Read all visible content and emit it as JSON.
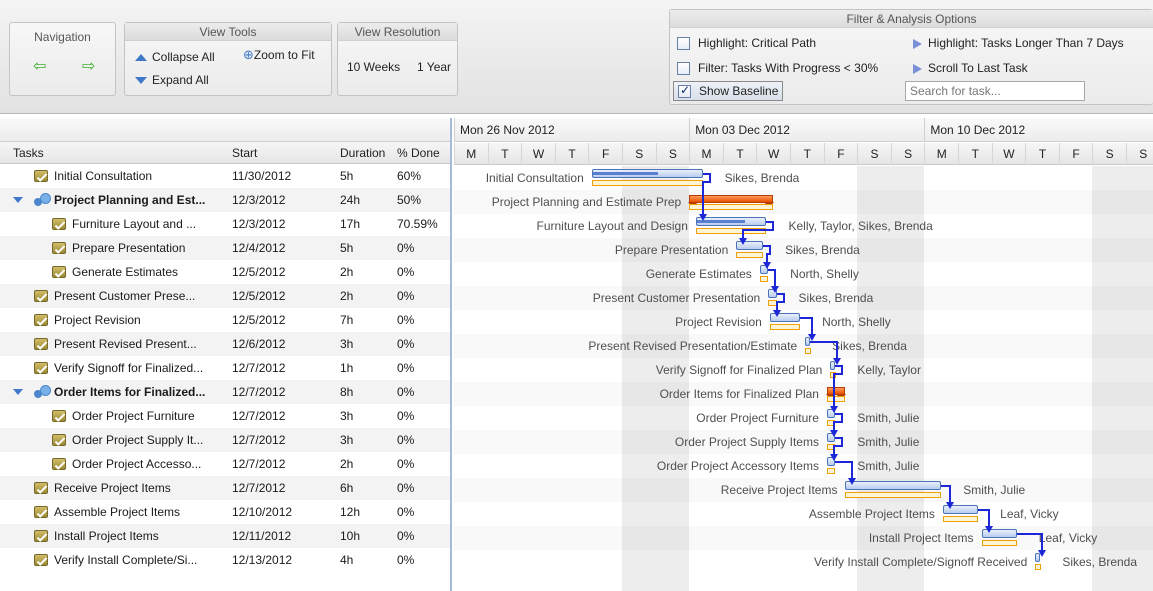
{
  "toolbar": {
    "navigation": {
      "title": "Navigation",
      "back_icon": "arrow-left-icon",
      "forward_icon": "arrow-right-icon"
    },
    "view_tools": {
      "title": "View Tools",
      "collapse_all": "Collapse All",
      "zoom_to_fit": "Zoom to Fit",
      "expand_all": "Expand All"
    },
    "view_resolution": {
      "title": "View Resolution",
      "weeks": "10 Weeks",
      "year": "1 Year"
    },
    "filter": {
      "title": "Filter & Analysis Options",
      "highlight_critical": "Highlight: Critical Path",
      "filter_progress": "Filter: Tasks With Progress < 30%",
      "show_baseline": "Show Baseline",
      "show_baseline_checked": true,
      "highlight_longer": "Highlight: Tasks Longer Than 7 Days",
      "scroll_last": "Scroll To Last Task",
      "search_placeholder": "Search for task..."
    }
  },
  "grid": {
    "columns": {
      "tasks": "Tasks",
      "start": "Start",
      "duration": "Duration",
      "done": "% Done"
    },
    "rows": [
      {
        "name": "Initial Consultation",
        "start": "11/30/2012",
        "duration": "5h",
        "done": "60%",
        "level": 0,
        "summary": false
      },
      {
        "name": "Project Planning and Est...",
        "start": "12/3/2012",
        "duration": "24h",
        "done": "50%",
        "level": 0,
        "summary": true
      },
      {
        "name": "Furniture Layout and ...",
        "start": "12/3/2012",
        "duration": "17h",
        "done": "70.59%",
        "level": 1,
        "summary": false
      },
      {
        "name": "Prepare Presentation",
        "start": "12/4/2012",
        "duration": "5h",
        "done": "0%",
        "level": 1,
        "summary": false
      },
      {
        "name": "Generate Estimates",
        "start": "12/5/2012",
        "duration": "2h",
        "done": "0%",
        "level": 1,
        "summary": false
      },
      {
        "name": "Present Customer Prese...",
        "start": "12/5/2012",
        "duration": "2h",
        "done": "0%",
        "level": 0,
        "summary": false
      },
      {
        "name": "Project Revision",
        "start": "12/5/2012",
        "duration": "7h",
        "done": "0%",
        "level": 0,
        "summary": false
      },
      {
        "name": "Present Revised Present...",
        "start": "12/6/2012",
        "duration": "3h",
        "done": "0%",
        "level": 0,
        "summary": false
      },
      {
        "name": "Verify Signoff for Finalized...",
        "start": "12/7/2012",
        "duration": "1h",
        "done": "0%",
        "level": 0,
        "summary": false
      },
      {
        "name": "Order Items for Finalized...",
        "start": "12/7/2012",
        "duration": "8h",
        "done": "0%",
        "level": 0,
        "summary": true
      },
      {
        "name": "Order Project Furniture",
        "start": "12/7/2012",
        "duration": "3h",
        "done": "0%",
        "level": 1,
        "summary": false
      },
      {
        "name": "Order Project Supply It...",
        "start": "12/7/2012",
        "duration": "3h",
        "done": "0%",
        "level": 1,
        "summary": false
      },
      {
        "name": "Order Project Accesso...",
        "start": "12/7/2012",
        "duration": "2h",
        "done": "0%",
        "level": 1,
        "summary": false
      },
      {
        "name": "Receive Project Items",
        "start": "12/7/2012",
        "duration": "6h",
        "done": "0%",
        "level": 0,
        "summary": false
      },
      {
        "name": "Assemble Project Items",
        "start": "12/10/2012",
        "duration": "12h",
        "done": "0%",
        "level": 0,
        "summary": false
      },
      {
        "name": "Install Project Items",
        "start": "12/11/2012",
        "duration": "10h",
        "done": "0%",
        "level": 0,
        "summary": false
      },
      {
        "name": "Verify Install Complete/Si...",
        "start": "12/13/2012",
        "duration": "4h",
        "done": "0%",
        "level": 0,
        "summary": false
      }
    ]
  },
  "timeline": {
    "weeks": [
      "Mon 26 Nov 2012",
      "Mon 03 Dec 2012",
      "Mon 10 Dec 2012"
    ],
    "days": [
      "M",
      "T",
      "W",
      "T",
      "F",
      "S",
      "S",
      "M",
      "T",
      "W",
      "T",
      "F",
      "S",
      "S",
      "M",
      "T",
      "W",
      "T",
      "F",
      "S",
      "S"
    ]
  },
  "gantt": {
    "tasks": [
      {
        "label": "Initial Consultation",
        "resource": "Sikes, Brenda",
        "start": 4.1,
        "end": 7.4,
        "progress": 0.6,
        "type": "task"
      },
      {
        "label": "Project Planning and Estimate Prep",
        "resource": "",
        "start": 7.0,
        "end": 9.5,
        "progress": 0.5,
        "type": "summary"
      },
      {
        "label": "Furniture Layout and Design",
        "resource": "Kelly, Taylor, Sikes, Brenda",
        "start": 7.2,
        "end": 9.3,
        "progress": 0.7059,
        "type": "task"
      },
      {
        "label": "Prepare Presentation",
        "resource": "Sikes, Brenda",
        "start": 8.4,
        "end": 9.2,
        "progress": 0.0,
        "type": "task"
      },
      {
        "label": "Generate Estimates",
        "resource": "North, Shelly",
        "start": 9.1,
        "end": 9.35,
        "progress": 0.0,
        "type": "task"
      },
      {
        "label": "Present Customer Presentation",
        "resource": "Sikes, Brenda",
        "start": 9.35,
        "end": 9.6,
        "progress": 0.0,
        "type": "task"
      },
      {
        "label": "Project Revision",
        "resource": "North, Shelly",
        "start": 9.4,
        "end": 10.3,
        "progress": 0.0,
        "type": "task"
      },
      {
        "label": "Present Revised Presentation/Estimate",
        "resource": "Sikes, Brenda",
        "start": 10.45,
        "end": 10.6,
        "progress": 0.0,
        "type": "task"
      },
      {
        "label": "Verify Signoff for Finalized Plan",
        "resource": "Kelly, Taylor",
        "start": 11.2,
        "end": 11.35,
        "progress": 0.0,
        "type": "task"
      },
      {
        "label": "Order Items for Finalized Plan",
        "resource": "",
        "start": 11.1,
        "end": 11.65,
        "progress": 0.0,
        "type": "summary"
      },
      {
        "label": "Order Project Furniture",
        "resource": "Smith, Julie",
        "start": 11.1,
        "end": 11.35,
        "progress": 0.0,
        "type": "task"
      },
      {
        "label": "Order Project Supply Items",
        "resource": "Smith, Julie",
        "start": 11.1,
        "end": 11.35,
        "progress": 0.0,
        "type": "task"
      },
      {
        "label": "Order Project Accessory Items",
        "resource": "Smith, Julie",
        "start": 11.1,
        "end": 11.35,
        "progress": 0.0,
        "type": "task"
      },
      {
        "label": "Receive Project Items",
        "resource": "Smith, Julie",
        "start": 11.65,
        "end": 14.5,
        "progress": 0.0,
        "type": "task"
      },
      {
        "label": "Assemble Project Items",
        "resource": "Leaf, Vicky",
        "start": 14.55,
        "end": 15.6,
        "progress": 0.0,
        "type": "task"
      },
      {
        "label": "Install Project Items",
        "resource": "Leaf, Vicky",
        "start": 15.7,
        "end": 16.75,
        "progress": 0.0,
        "type": "task"
      },
      {
        "label": "Verify Install Complete/Signoff Received",
        "resource": "Sikes, Brenda",
        "start": 17.3,
        "end": 17.45,
        "progress": 0.0,
        "type": "task"
      }
    ]
  },
  "colors": {
    "bar_border": "#4a74b6",
    "progress": "#5b7fd0",
    "baseline": "#f0a000",
    "summary": "#e85000",
    "dependency": "#1c28d8",
    "weekend": "#ededed"
  }
}
